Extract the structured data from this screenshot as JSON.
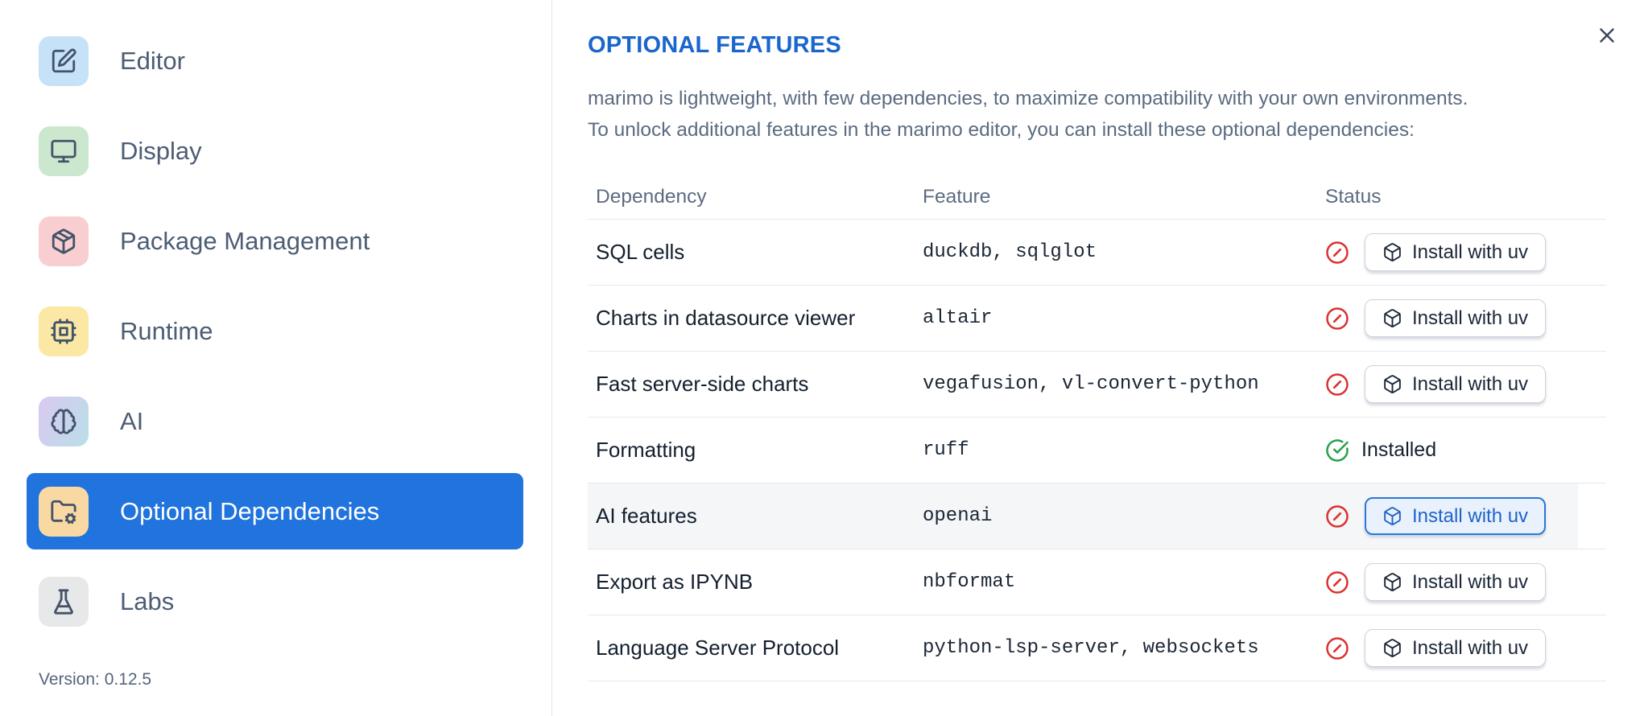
{
  "sidebar": {
    "items": [
      {
        "label": "Editor",
        "icon": "edit-icon",
        "icon_style": "background:#c6e2f9"
      },
      {
        "label": "Display",
        "icon": "monitor-icon",
        "icon_style": "background:#cbe8ce"
      },
      {
        "label": "Package Management",
        "icon": "package-icon",
        "icon_style": "background:#f9ced1"
      },
      {
        "label": "Runtime",
        "icon": "cpu-icon",
        "icon_style": "background:#fae8a4"
      },
      {
        "label": "AI",
        "icon": "brain-icon",
        "icon_style": "background:linear-gradient(115deg,#dac9f0 0%,#b9dfe7 100%)"
      },
      {
        "label": "Optional Dependencies",
        "icon": "folder-cog-icon",
        "icon_style": "background:#f9d9a3"
      },
      {
        "label": "Labs",
        "icon": "flask-icon",
        "icon_style": "background:#e7e8ea"
      }
    ],
    "selected_item": "Optional Dependencies",
    "version_label": "Version: 0.12.5"
  },
  "dialog": {
    "title": "OPTIONAL FEATURES",
    "description": [
      "marimo is lightweight, with few dependencies, to maximize compatibility with your own environments.",
      "To unlock additional features in the marimo editor, you can install these optional dependencies:"
    ]
  },
  "table": {
    "headers": {
      "dependency": "Dependency",
      "feature": "Feature",
      "status": "Status"
    },
    "install_button_label": "Install with uv",
    "installed_label": "Installed",
    "rows": [
      {
        "dependency": "SQL cells",
        "feature": "duckdb, sqlglot",
        "status": "not_installed"
      },
      {
        "dependency": "Charts in datasource viewer",
        "feature": "altair",
        "status": "not_installed"
      },
      {
        "dependency": "Fast server-side charts",
        "feature": "vegafusion, vl-convert-python",
        "status": "not_installed"
      },
      {
        "dependency": "Formatting",
        "feature": "ruff",
        "status": "installed"
      },
      {
        "dependency": "AI features",
        "feature": "openai",
        "status": "not_installed",
        "highlighted": true,
        "button_focused": true
      },
      {
        "dependency": "Export as IPYNB",
        "feature": "nbformat",
        "status": "not_installed"
      },
      {
        "dependency": "Language Server Protocol",
        "feature": "python-lsp-server, websockets",
        "status": "not_installed"
      }
    ]
  },
  "colors": {
    "accent_blue": "#2173dd",
    "title_blue": "#1a66cc",
    "focused_button_blue": "#2a79d8",
    "error_red": "#dd3030",
    "success_green": "#23a24d"
  }
}
